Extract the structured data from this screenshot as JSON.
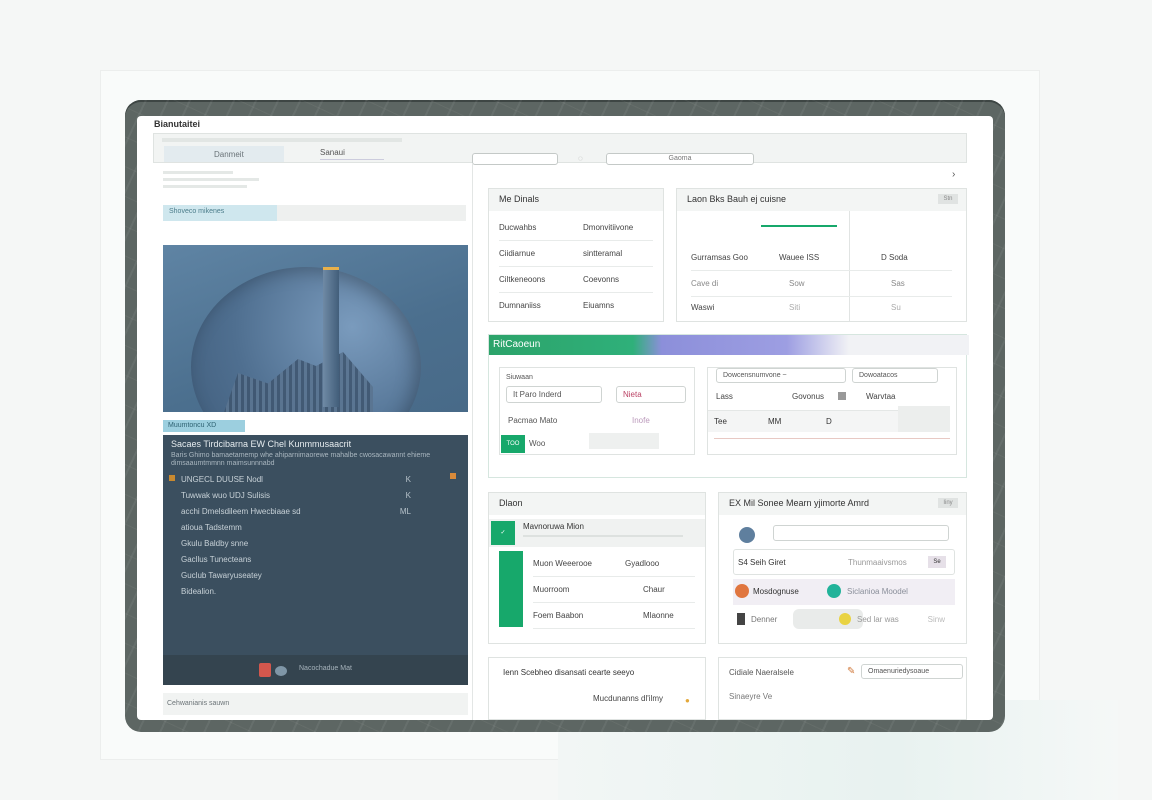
{
  "window": {
    "title": "Bianutaitei"
  },
  "toolbar": {
    "tab_label": "Danmeit",
    "field_label": "Sanaui",
    "input1": "",
    "input2": "Gaoma"
  },
  "left_panel": {
    "section_tag": "Shoveco mikenes",
    "chip_label": "Muumtoncu XD",
    "dark_card": {
      "title": "Sacaes Tirdcibarna   EW Chel Kunmmusaacrit",
      "subtitle": "Baris Ghimo bamaetamemp whe ahiparnimaorewe mahalbe cwosacawannt ehieme dimsaaumtmmnn maimsunnnabd",
      "items": [
        {
          "label": "UNGECL DUUSE Nodl",
          "value": "K"
        },
        {
          "label": "Tuwwak wuo        UDJ  Sulisis",
          "value": "K"
        },
        {
          "label": "acchi   Dmelsdileem   Hwecbiaae sd",
          "value": "ML"
        },
        {
          "label": "atioua   Tadstemm",
          "value": ""
        },
        {
          "label": "Gkulu   Baldby snne",
          "value": ""
        },
        {
          "label": "Gacllus   Tunecteans",
          "value": ""
        },
        {
          "label": "Guclub   Tawaryuseatey",
          "value": ""
        },
        {
          "label": "Bidealion.",
          "value": ""
        }
      ],
      "footer_text": "Nacochadue Mat"
    },
    "bottom_label": "Cehwanianis sauwn"
  },
  "cards": {
    "c1": {
      "title": "Me Dinals",
      "rows": [
        {
          "a": "Ducwahbs",
          "b": "Dmonvitiivone"
        },
        {
          "a": "Ciidiarnue",
          "b": "sintteramal"
        },
        {
          "a": "Ciltkeneoons",
          "b": "Coevonns"
        },
        {
          "a": "Dumnaniiss",
          "b": "Eiuamns"
        }
      ]
    },
    "c2": {
      "title": "Laon Bks Bauh ej cuisne",
      "tag": "Stn",
      "rows": [
        {
          "a": "Gurramsas  Goo",
          "b": "Wauee ISS",
          "c": "D  Soda"
        },
        {
          "a": "Cave di",
          "b": "Sow",
          "c": "Sas"
        },
        {
          "a": "Waswi",
          "b": "Siti",
          "c": "Su"
        }
      ]
    },
    "c3": {
      "title": "RitCaoeun",
      "left_label": "Siuwaan",
      "left_rows": [
        {
          "a": "It Paro Inderd",
          "b": "Nieta"
        },
        {
          "a": "Pacmao Mato",
          "b": "Inofe"
        }
      ],
      "green_label": "Woo",
      "chip": "TOO",
      "right_header": "Dowcensnumvone ~",
      "right_header2": "Dowoatacos",
      "right_rows": [
        {
          "a": "Lass",
          "b": "Govonus",
          "c": "Warvtaa"
        },
        {
          "a": "Tee",
          "b": "MM",
          "c": "D"
        }
      ]
    },
    "c4": {
      "title": "Dlaon",
      "head_row": "Mavnoruwa Mion",
      "rows": [
        {
          "a": "Muon Weeerooe",
          "b": "Gyadlooo"
        },
        {
          "a": "Muorroom",
          "b": "Chaur"
        },
        {
          "a": "Foem Baabon",
          "b": "Mlaonne"
        }
      ]
    },
    "c5": {
      "title": "EX Mil Sonee Mearn yjimorte Amrd",
      "tag": "Iiny",
      "search_placeholder": "",
      "rows": [
        {
          "icon": "user-icon",
          "a": "S4 Seih Giret",
          "b": "Thunmaaivsmos",
          "badge": "Se"
        },
        {
          "icon": "fire-icon",
          "a": "Mosdognuse",
          "b": "Siclanioa Moodel"
        },
        {
          "icon": "doc-icon",
          "a": "Denner",
          "b": "Sed lar was",
          "c": "Sinw"
        }
      ]
    },
    "c6": {
      "title": "Ienn Scebheo disansati cearte seeyo",
      "sub": "Mucdunanns dl'ilmy"
    },
    "c7": {
      "title": "Cidiale Naeralsele",
      "input": "Omaenuriedysoaue",
      "sub": "Sinaeyre Ve"
    }
  },
  "colors": {
    "accent_green": "#17a86b",
    "accent_purple": "#9d9ee2",
    "dark_panel": "#3b4f5f",
    "frame": "#5d6663"
  }
}
